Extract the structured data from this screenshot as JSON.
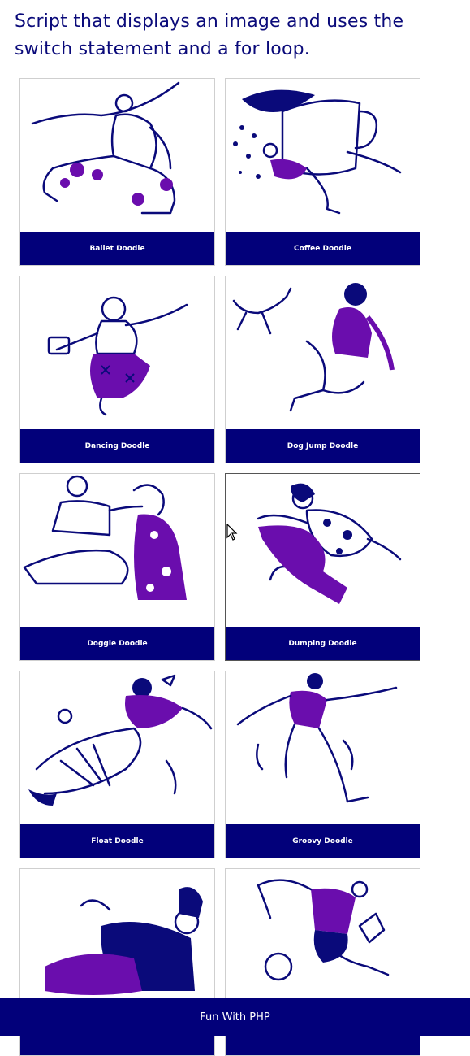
{
  "page": {
    "heading": "Script that displays an image and uses the switch statement and a for loop.",
    "footer_text": "Fun With PHP"
  },
  "colors": {
    "accent": "#02007a",
    "ink": "#0a0a7a",
    "purple": "#6a0dad"
  },
  "doodles": [
    {
      "label": "Ballet Doodle",
      "icon": "ballet-dancer-illustration"
    },
    {
      "label": "Coffee Doodle",
      "icon": "coffee-cup-person-illustration"
    },
    {
      "label": "Dancing Doodle",
      "icon": "dancing-person-illustration"
    },
    {
      "label": "Dog Jump Doodle",
      "icon": "dog-jump-illustration"
    },
    {
      "label": "Doggie Doodle",
      "icon": "person-with-dog-illustration"
    },
    {
      "label": "Dumping Doodle",
      "icon": "jumping-person-illustration"
    },
    {
      "label": "Float Doodle",
      "icon": "floating-person-illustration"
    },
    {
      "label": "Groovy Doodle",
      "icon": "groovy-dancer-illustration"
    },
    {
      "label": "",
      "icon": "sitting-person-illustration"
    },
    {
      "label": "",
      "icon": "juggling-person-illustration"
    }
  ]
}
